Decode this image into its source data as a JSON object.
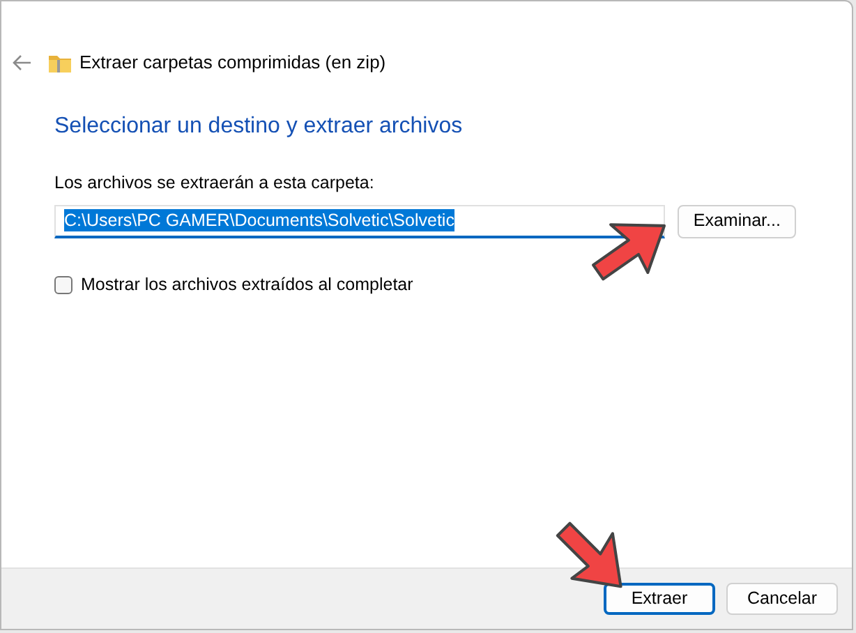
{
  "window": {
    "title": "Extraer carpetas comprimidas (en zip)"
  },
  "heading": "Seleccionar un destino y extraer archivos",
  "destination": {
    "label": "Los archivos se extraerán a esta carpeta:",
    "value": "C:\\Users\\PC GAMER\\Documents\\Solvetic\\Solvetic",
    "selected": true
  },
  "browse_button": "Examinar...",
  "show_files": {
    "label": "Mostrar los archivos extraídos al completar",
    "checked": false
  },
  "buttons": [
    {
      "label": "Extraer",
      "selected": true
    },
    {
      "label": "Cancelar",
      "selected": false
    }
  ]
}
